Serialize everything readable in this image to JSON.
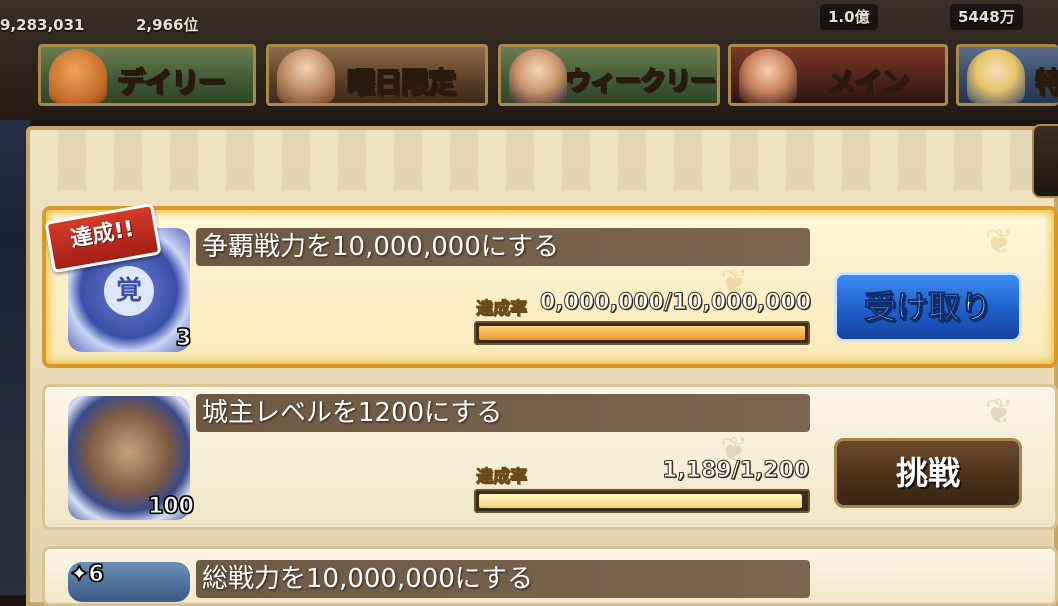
{
  "top_bar": {
    "left_value": "9,283,031",
    "rank_value": "2,966位",
    "mid_value": "1.0億",
    "right_value": "5448万"
  },
  "tabs": [
    {
      "label": "デイリー",
      "icon": "egg-mascot-icon"
    },
    {
      "label": "曜日限定",
      "icon": "swordsman-portrait-icon"
    },
    {
      "label": "ウィークリー",
      "icon": "hero-portrait-icon"
    },
    {
      "label": "メイン",
      "icon": "warrior-portrait-icon"
    },
    {
      "label": "特",
      "icon": "blonde-portrait-icon"
    }
  ],
  "missions": [
    {
      "title": "争覇戦力を10,000,000にする",
      "badge": "達成!!",
      "reward_icon": "awakening-scroll-icon",
      "reward_glyph": "覚",
      "reward_count": "3",
      "rate_label": "達成率",
      "progress_text": "0,000,000/10,000,000",
      "progress_fraction": 1.0,
      "button_label": "受け取り",
      "button_color": "#1f5fc9"
    },
    {
      "title": "城主レベルを1200にする",
      "reward_icon": "general-portrait-icon",
      "reward_count": "100",
      "rate_label": "達成率",
      "progress_text": "1,189/1,200",
      "progress_fraction": 0.991,
      "button_label": "挑戦",
      "button_color": "#4a3019"
    },
    {
      "title": "総戦力を10,000,000にする",
      "reward_icon": "item-card-icon",
      "reward_count": "6"
    }
  ]
}
